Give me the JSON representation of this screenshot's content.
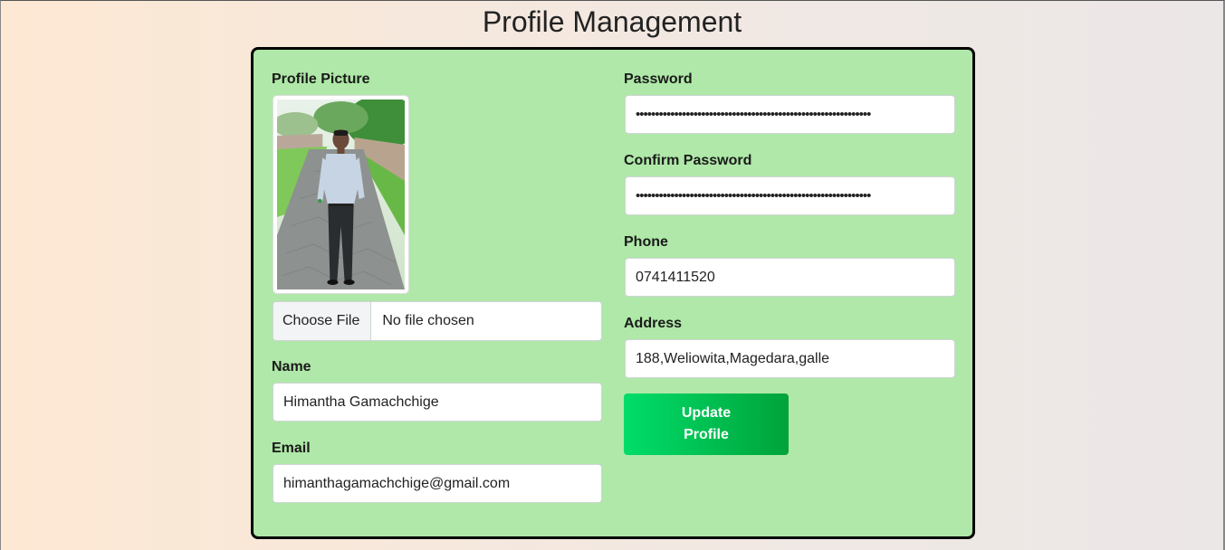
{
  "page": {
    "title": "Profile Management"
  },
  "profile_picture": {
    "label": "Profile Picture",
    "file_button": "Choose File",
    "file_status": "No file chosen"
  },
  "name": {
    "label": "Name",
    "value": "Himantha Gamachchige"
  },
  "email": {
    "label": "Email",
    "value": "himanthagamachchige@gmail.com"
  },
  "password": {
    "label": "Password",
    "value": "•••••••••••••••••••••••••••••••••••••••••••••••••••••••••••••"
  },
  "confirm_password": {
    "label": "Confirm Password",
    "value": "•••••••••••••••••••••••••••••••••••••••••••••••••••••••••••••"
  },
  "phone": {
    "label": "Phone",
    "value": "0741411520"
  },
  "address": {
    "label": "Address",
    "value": "188,Weliowita,Magedara,galle"
  },
  "actions": {
    "update_label": "Update Profile"
  },
  "colors": {
    "card_bg": "#afe8a8",
    "button_start": "#00dd6a",
    "button_end": "#00a33a"
  }
}
